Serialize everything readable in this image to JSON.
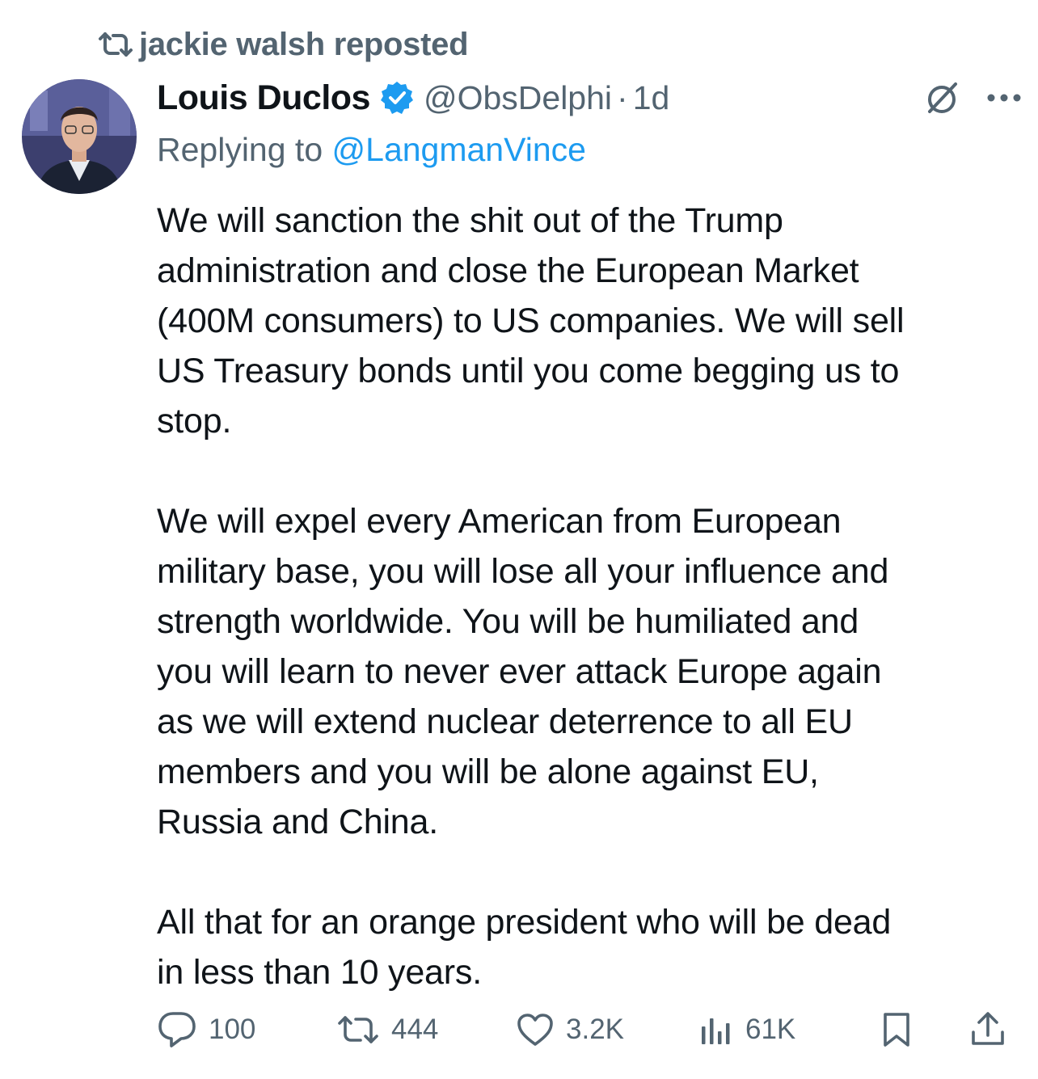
{
  "repost": {
    "label": "jackie walsh reposted"
  },
  "author": {
    "name": "Louis Duclos",
    "handle": "@ObsDelphi",
    "separator": "·",
    "time": "1d"
  },
  "reply": {
    "prefix": "Replying to ",
    "handle": "@LangmanVince"
  },
  "body": {
    "paragraphs": [
      "We will sanction the shit out of the Trump\nadministration and close the European Market\n(400M consumers) to US companies. We will sell\nUS Treasury bonds until you come begging us to\nstop.",
      "We will expel every American from European\nmilitary base, you will lose all your influence and\nstrength worldwide. You will be humiliated and\nyou will learn to never ever attack Europe again\nas we will extend nuclear deterrence to all EU\nmembers and you will be alone against EU,\nRussia and China.",
      "All that for an orange president who will be dead\nin less than 10 years."
    ]
  },
  "actions": {
    "replies": "100",
    "reposts": "444",
    "likes": "3.2K",
    "views": "61K"
  },
  "icons": {
    "repost": "repost-icon",
    "verified": "verified-badge-icon",
    "grok": "grok-icon",
    "more": "more-icon",
    "reply": "reply-icon",
    "like": "heart-icon",
    "views": "views-icon",
    "bookmark": "bookmark-icon",
    "share": "share-icon"
  },
  "colors": {
    "text": "#0f1419",
    "muted": "#536471",
    "link": "#1d9bf0",
    "verified": "#1d9bf0"
  }
}
